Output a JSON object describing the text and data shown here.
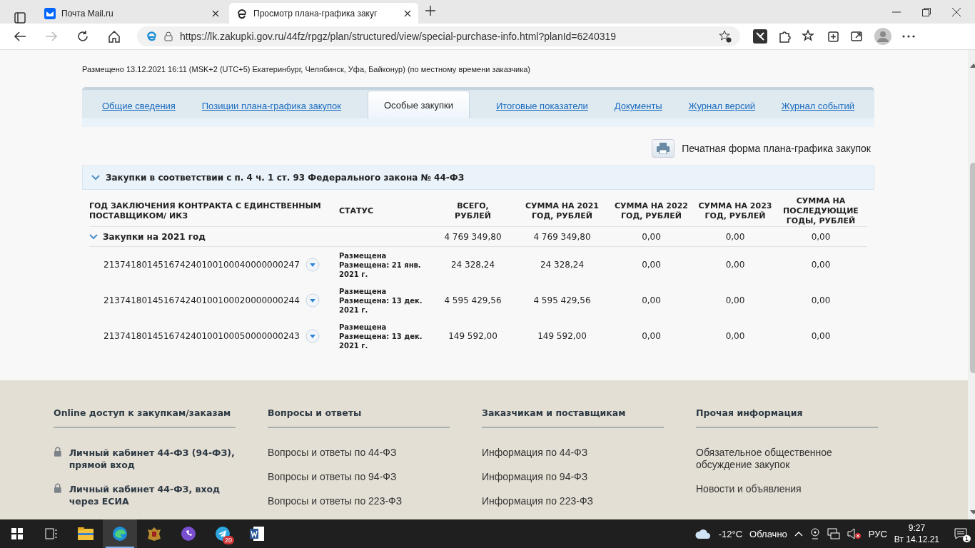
{
  "browser": {
    "tabs": [
      {
        "title": "Почта Mail.ru",
        "selected": false
      },
      {
        "title": "Просмотр плана-графика закуг",
        "selected": true
      }
    ],
    "url": "https://lk.zakupki.gov.ru/44fz/rpgz/plan/structured/view/special-purchase-info.html?planId=6240319"
  },
  "placement": "Размещено 13.12.2021 16:11 (MSK+2 (UTC+5) Екатеринбург, Челябинск, Уфа, Байконур) (по местному времени заказчика)",
  "tabs": [
    {
      "label": "Общие сведения",
      "selected": false
    },
    {
      "label": "Позиции плана-графика закупок",
      "selected": false
    },
    {
      "label": "Особые закупки",
      "selected": true
    },
    {
      "label": "Итоговые показатели",
      "selected": false
    },
    {
      "label": "Документы",
      "selected": false
    },
    {
      "label": "Журнал версий",
      "selected": false
    },
    {
      "label": "Журнал событий",
      "selected": false
    }
  ],
  "print_button": "Печатная форма плана-графика закупок",
  "section": {
    "title": "Закупки в соответствии с п. 4 ч. 1 ст. 93 Федерального закона № 44-ФЗ",
    "expanded": true
  },
  "table": {
    "columns": [
      "ГОД ЗАКЛЮЧЕНИЯ КОНТРАКТА С ЕДИНСТВЕННЫМ ПОСТАВЩИКОМ/ ИКЗ",
      "СТАТУС",
      "ВСЕГО, РУБЛЕЙ",
      "СУММА НА 2021 ГОД, РУБЛЕЙ",
      "СУММА НА 2022 ГОД, РУБЛЕЙ",
      "СУММА НА 2023 ГОД, РУБЛЕЙ",
      "СУММА НА ПОСЛЕДУЮЩИЕ ГОДЫ, РУБЛЕЙ"
    ],
    "groups": [
      {
        "title": "Закупки на 2021 год",
        "expanded": true,
        "values": [
          "4 769 349,80",
          "4 769 349,80",
          "0,00",
          "0,00",
          "0,00"
        ],
        "rows": [
          {
            "ikz": "213741801451674240100100040000000247",
            "status": "Размещена",
            "status_detail": "Размещена: 21 янв. 2021 г.",
            "values": [
              "24 328,24",
              "24 328,24",
              "0,00",
              "0,00",
              "0,00"
            ]
          },
          {
            "ikz": "213741801451674240100100020000000244",
            "status": "Размещена",
            "status_detail": "Размещена: 13 дек. 2021 г.",
            "values": [
              "4 595 429,56",
              "4 595 429,56",
              "0,00",
              "0,00",
              "0,00"
            ]
          },
          {
            "ikz": "213741801451674240100100050000000243",
            "status": "Размещена",
            "status_detail": "Размещена: 13 дек. 2021 г.",
            "values": [
              "149 592,00",
              "149 592,00",
              "0,00",
              "0,00",
              "0,00"
            ]
          }
        ]
      }
    ]
  },
  "footer": [
    {
      "title": "Online доступ к закупкам/заказам",
      "links": [
        {
          "text": "Личный кабинет 44-ФЗ (94-ФЗ), прямой вход",
          "kind": "locked"
        },
        {
          "text": "Личный кабинет 44-ФЗ, вход через ЕСИА",
          "kind": "locked"
        }
      ]
    },
    {
      "title": "Вопросы и ответы",
      "links": [
        {
          "text": "Вопросы и ответы по 44-ФЗ",
          "kind": "plain"
        },
        {
          "text": "Вопросы и ответы по 94-ФЗ",
          "kind": "plain"
        },
        {
          "text": "Вопросы и ответы по 223-ФЗ",
          "kind": "plain"
        }
      ]
    },
    {
      "title": "Заказчикам и поставщикам",
      "links": [
        {
          "text": "Информация по 44-ФЗ",
          "kind": "plain"
        },
        {
          "text": "Информация по 94-ФЗ",
          "kind": "plain"
        },
        {
          "text": "Информация по 223-ФЗ",
          "kind": "plain"
        }
      ]
    },
    {
      "title": "Прочая информация",
      "links": [
        {
          "text": "Обязательное общественное обсуждение закупок",
          "kind": "plain"
        },
        {
          "text": "Новости и объявления",
          "kind": "plain"
        }
      ]
    }
  ],
  "taskbar": {
    "apps": [
      {
        "kind": "explorer",
        "active": false
      },
      {
        "kind": "edge",
        "active": true
      },
      {
        "kind": "emblem",
        "active": false
      },
      {
        "kind": "viber",
        "active": false
      },
      {
        "kind": "telegram",
        "active": false,
        "badge": "20"
      },
      {
        "kind": "word",
        "active": false
      }
    ],
    "weather": "-12°C",
    "weather_text": "Облачно",
    "language": "РУС",
    "time": "9:27",
    "date": "Вт 14.12.21",
    "notifications": "1"
  }
}
